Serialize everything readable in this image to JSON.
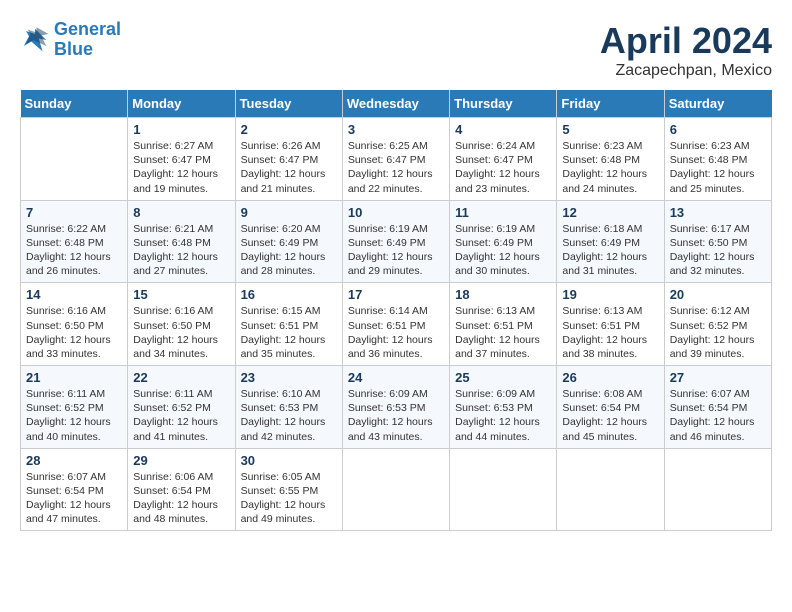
{
  "header": {
    "logo_line1": "General",
    "logo_line2": "Blue",
    "month": "April 2024",
    "location": "Zacapechpan, Mexico"
  },
  "days_of_week": [
    "Sunday",
    "Monday",
    "Tuesday",
    "Wednesday",
    "Thursday",
    "Friday",
    "Saturday"
  ],
  "weeks": [
    [
      {
        "num": "",
        "sunrise": "",
        "sunset": "",
        "daylight": ""
      },
      {
        "num": "1",
        "sunrise": "6:27 AM",
        "sunset": "6:47 PM",
        "daylight": "12 hours and 19 minutes."
      },
      {
        "num": "2",
        "sunrise": "6:26 AM",
        "sunset": "6:47 PM",
        "daylight": "12 hours and 21 minutes."
      },
      {
        "num": "3",
        "sunrise": "6:25 AM",
        "sunset": "6:47 PM",
        "daylight": "12 hours and 22 minutes."
      },
      {
        "num": "4",
        "sunrise": "6:24 AM",
        "sunset": "6:47 PM",
        "daylight": "12 hours and 23 minutes."
      },
      {
        "num": "5",
        "sunrise": "6:23 AM",
        "sunset": "6:48 PM",
        "daylight": "12 hours and 24 minutes."
      },
      {
        "num": "6",
        "sunrise": "6:23 AM",
        "sunset": "6:48 PM",
        "daylight": "12 hours and 25 minutes."
      }
    ],
    [
      {
        "num": "7",
        "sunrise": "6:22 AM",
        "sunset": "6:48 PM",
        "daylight": "12 hours and 26 minutes."
      },
      {
        "num": "8",
        "sunrise": "6:21 AM",
        "sunset": "6:48 PM",
        "daylight": "12 hours and 27 minutes."
      },
      {
        "num": "9",
        "sunrise": "6:20 AM",
        "sunset": "6:49 PM",
        "daylight": "12 hours and 28 minutes."
      },
      {
        "num": "10",
        "sunrise": "6:19 AM",
        "sunset": "6:49 PM",
        "daylight": "12 hours and 29 minutes."
      },
      {
        "num": "11",
        "sunrise": "6:19 AM",
        "sunset": "6:49 PM",
        "daylight": "12 hours and 30 minutes."
      },
      {
        "num": "12",
        "sunrise": "6:18 AM",
        "sunset": "6:49 PM",
        "daylight": "12 hours and 31 minutes."
      },
      {
        "num": "13",
        "sunrise": "6:17 AM",
        "sunset": "6:50 PM",
        "daylight": "12 hours and 32 minutes."
      }
    ],
    [
      {
        "num": "14",
        "sunrise": "6:16 AM",
        "sunset": "6:50 PM",
        "daylight": "12 hours and 33 minutes."
      },
      {
        "num": "15",
        "sunrise": "6:16 AM",
        "sunset": "6:50 PM",
        "daylight": "12 hours and 34 minutes."
      },
      {
        "num": "16",
        "sunrise": "6:15 AM",
        "sunset": "6:51 PM",
        "daylight": "12 hours and 35 minutes."
      },
      {
        "num": "17",
        "sunrise": "6:14 AM",
        "sunset": "6:51 PM",
        "daylight": "12 hours and 36 minutes."
      },
      {
        "num": "18",
        "sunrise": "6:13 AM",
        "sunset": "6:51 PM",
        "daylight": "12 hours and 37 minutes."
      },
      {
        "num": "19",
        "sunrise": "6:13 AM",
        "sunset": "6:51 PM",
        "daylight": "12 hours and 38 minutes."
      },
      {
        "num": "20",
        "sunrise": "6:12 AM",
        "sunset": "6:52 PM",
        "daylight": "12 hours and 39 minutes."
      }
    ],
    [
      {
        "num": "21",
        "sunrise": "6:11 AM",
        "sunset": "6:52 PM",
        "daylight": "12 hours and 40 minutes."
      },
      {
        "num": "22",
        "sunrise": "6:11 AM",
        "sunset": "6:52 PM",
        "daylight": "12 hours and 41 minutes."
      },
      {
        "num": "23",
        "sunrise": "6:10 AM",
        "sunset": "6:53 PM",
        "daylight": "12 hours and 42 minutes."
      },
      {
        "num": "24",
        "sunrise": "6:09 AM",
        "sunset": "6:53 PM",
        "daylight": "12 hours and 43 minutes."
      },
      {
        "num": "25",
        "sunrise": "6:09 AM",
        "sunset": "6:53 PM",
        "daylight": "12 hours and 44 minutes."
      },
      {
        "num": "26",
        "sunrise": "6:08 AM",
        "sunset": "6:54 PM",
        "daylight": "12 hours and 45 minutes."
      },
      {
        "num": "27",
        "sunrise": "6:07 AM",
        "sunset": "6:54 PM",
        "daylight": "12 hours and 46 minutes."
      }
    ],
    [
      {
        "num": "28",
        "sunrise": "6:07 AM",
        "sunset": "6:54 PM",
        "daylight": "12 hours and 47 minutes."
      },
      {
        "num": "29",
        "sunrise": "6:06 AM",
        "sunset": "6:54 PM",
        "daylight": "12 hours and 48 minutes."
      },
      {
        "num": "30",
        "sunrise": "6:05 AM",
        "sunset": "6:55 PM",
        "daylight": "12 hours and 49 minutes."
      },
      {
        "num": "",
        "sunrise": "",
        "sunset": "",
        "daylight": ""
      },
      {
        "num": "",
        "sunrise": "",
        "sunset": "",
        "daylight": ""
      },
      {
        "num": "",
        "sunrise": "",
        "sunset": "",
        "daylight": ""
      },
      {
        "num": "",
        "sunrise": "",
        "sunset": "",
        "daylight": ""
      }
    ]
  ]
}
